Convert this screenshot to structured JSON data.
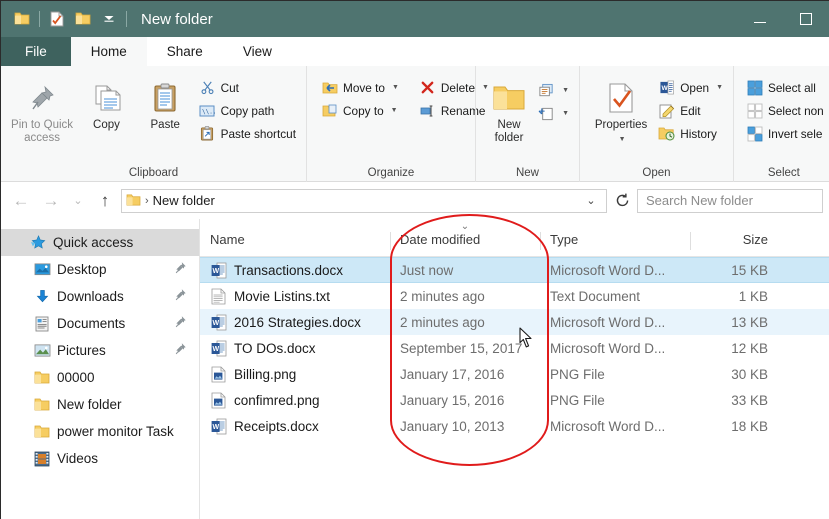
{
  "window": {
    "title": "New folder",
    "quick_access_toolbar": [
      {
        "name": "folder-icon",
        "label": "Folder"
      },
      {
        "name": "properties-icon",
        "label": "Properties"
      },
      {
        "name": "new-folder-icon",
        "label": "New folder"
      },
      {
        "name": "customize-chevron-icon",
        "label": "Customize Quick Access Toolbar"
      }
    ],
    "caption_buttons": [
      {
        "name": "minimize-button",
        "label": "Minimize"
      },
      {
        "name": "maximize-button",
        "label": "Maximize"
      }
    ]
  },
  "tabs": [
    {
      "label": "File",
      "state": "file"
    },
    {
      "label": "Home",
      "state": "active"
    },
    {
      "label": "Share",
      "state": "normal"
    },
    {
      "label": "View",
      "state": "normal"
    }
  ],
  "ribbon": {
    "groups": [
      {
        "name": "clipboard",
        "label": "Clipboard",
        "big_buttons": [
          {
            "label": "Pin to Quick access",
            "icon": "pin-icon",
            "dim": true
          },
          {
            "label": "Copy",
            "icon": "copy-icon",
            "dim": false
          },
          {
            "label": "Paste",
            "icon": "paste-icon",
            "dim": false
          }
        ],
        "small_buttons": [
          {
            "label": "Cut",
            "icon": "scissors-icon",
            "caret": false
          },
          {
            "label": "Copy path",
            "icon": "copy-path-icon",
            "caret": false
          },
          {
            "label": "Paste shortcut",
            "icon": "paste-shortcut-icon",
            "caret": false
          }
        ]
      },
      {
        "name": "organize",
        "label": "Organize",
        "small_buttons_a": [
          {
            "label": "Move to",
            "icon": "move-to-icon",
            "caret": true
          },
          {
            "label": "Copy to",
            "icon": "copy-to-icon",
            "caret": true
          }
        ],
        "small_buttons_b": [
          {
            "label": "Delete",
            "icon": "delete-icon",
            "caret": true
          },
          {
            "label": "Rename",
            "icon": "rename-icon",
            "caret": false
          }
        ]
      },
      {
        "name": "new",
        "label": "New",
        "big_buttons": [
          {
            "label": "New folder",
            "icon": "new-folder-icon",
            "dim": false
          }
        ],
        "small_buttons": [
          {
            "label": "",
            "icon": "new-item-icon",
            "caret": true
          },
          {
            "label": "",
            "icon": "easy-access-icon",
            "caret": true
          }
        ]
      },
      {
        "name": "open",
        "label": "Open",
        "big_buttons": [
          {
            "label": "Properties",
            "icon": "properties-icon",
            "dim": false,
            "caret": true
          }
        ],
        "small_buttons": [
          {
            "label": "Open",
            "icon": "word-open-icon",
            "caret": true
          },
          {
            "label": "Edit",
            "icon": "edit-icon",
            "caret": false
          },
          {
            "label": "History",
            "icon": "history-icon",
            "caret": false
          }
        ]
      },
      {
        "name": "select",
        "label": "Select",
        "small_buttons": [
          {
            "label": "Select all",
            "icon": "select-all-icon",
            "caret": false
          },
          {
            "label": "Select non",
            "icon": "select-none-icon",
            "caret": false
          },
          {
            "label": "Invert sele",
            "icon": "invert-selection-icon",
            "caret": false
          }
        ]
      }
    ]
  },
  "address_bar": {
    "back_label": "Back",
    "forward_label": "Forward",
    "recent_label": "Recent locations",
    "up_label": "Up",
    "breadcrumb": [
      "New folder"
    ],
    "separator": "›",
    "dropdown_label": "Previous locations",
    "refresh_label": "Refresh",
    "search_placeholder": "Search New folder"
  },
  "sidebar": {
    "items": [
      {
        "label": "Quick access",
        "icon": "quick-access-star-icon",
        "level": "root",
        "pinned": false
      },
      {
        "label": "Desktop",
        "icon": "desktop-icon",
        "level": "child",
        "pinned": true
      },
      {
        "label": "Downloads",
        "icon": "downloads-icon",
        "level": "child",
        "pinned": true
      },
      {
        "label": "Documents",
        "icon": "documents-icon",
        "level": "child",
        "pinned": true
      },
      {
        "label": "Pictures",
        "icon": "pictures-icon",
        "level": "child",
        "pinned": true
      },
      {
        "label": "00000",
        "icon": "folder-icon",
        "level": "child",
        "pinned": false
      },
      {
        "label": "New folder",
        "icon": "folder-icon",
        "level": "child",
        "pinned": false
      },
      {
        "label": "power monitor Task",
        "icon": "folder-icon",
        "level": "child",
        "pinned": false
      },
      {
        "label": "Videos",
        "icon": "videos-icon",
        "level": "child",
        "pinned": false
      }
    ]
  },
  "filelist": {
    "columns": [
      {
        "key": "name",
        "label": "Name",
        "sorted": false
      },
      {
        "key": "date",
        "label": "Date modified",
        "sorted": true,
        "sort_direction": "descending"
      },
      {
        "key": "type",
        "label": "Type",
        "sorted": false
      },
      {
        "key": "size",
        "label": "Size",
        "sorted": false
      }
    ],
    "rows": [
      {
        "name": "Transactions.docx",
        "date": "Just now",
        "type": "Microsoft Word D...",
        "size": "15 KB",
        "icon": "word-document-icon",
        "state": "selected"
      },
      {
        "name": "Movie Listins.txt",
        "date": "2 minutes ago",
        "type": "Text Document",
        "size": "1 KB",
        "icon": "text-document-icon",
        "state": "normal"
      },
      {
        "name": "2016 Strategies.docx",
        "date": "2 minutes ago",
        "type": "Microsoft Word D...",
        "size": "13 KB",
        "icon": "word-document-icon",
        "state": "hover"
      },
      {
        "name": "TO DOs.docx",
        "date": "September 15, 2017",
        "type": "Microsoft Word D...",
        "size": "12 KB",
        "icon": "word-document-icon",
        "state": "normal"
      },
      {
        "name": "Billing.png",
        "date": "January 17, 2016",
        "type": "PNG File",
        "size": "30 KB",
        "icon": "png-image-icon",
        "state": "normal"
      },
      {
        "name": "confimred.png",
        "date": "January 15, 2016",
        "type": "PNG File",
        "size": "33 KB",
        "icon": "png-image-icon",
        "state": "normal"
      },
      {
        "name": "Receipts.docx",
        "date": "January 10, 2013",
        "type": "Microsoft Word D...",
        "size": "18 KB",
        "icon": "word-document-icon",
        "state": "normal"
      }
    ]
  },
  "annotation": {
    "shape": "oval",
    "color": "#e01b1b",
    "target": "Date modified column"
  },
  "colors": {
    "titlebar": "#4f7470",
    "file_tab": "#3e625e",
    "ribbon_bg": "#f7f8f8",
    "selection": "#cde8f7",
    "hover": "#e8f4fc",
    "annotation_red": "#e01b1b"
  }
}
